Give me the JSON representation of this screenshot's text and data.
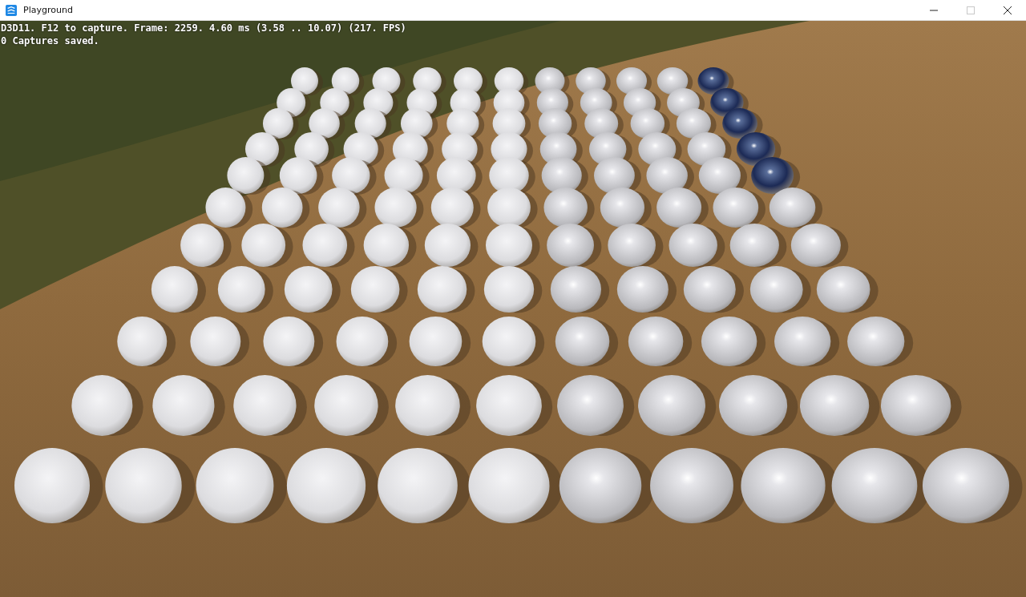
{
  "window": {
    "title": "Playground"
  },
  "controls": [
    {
      "kind": "minimize",
      "disabled": false
    },
    {
      "kind": "maximize",
      "disabled": true
    },
    {
      "kind": "close",
      "disabled": false
    }
  ],
  "overlay": [
    "D3D11. F12 to capture. Frame: 2259. 4.60 ms (3.58 .. 10.07) (217. FPS)",
    "0 Captures saved."
  ]
}
